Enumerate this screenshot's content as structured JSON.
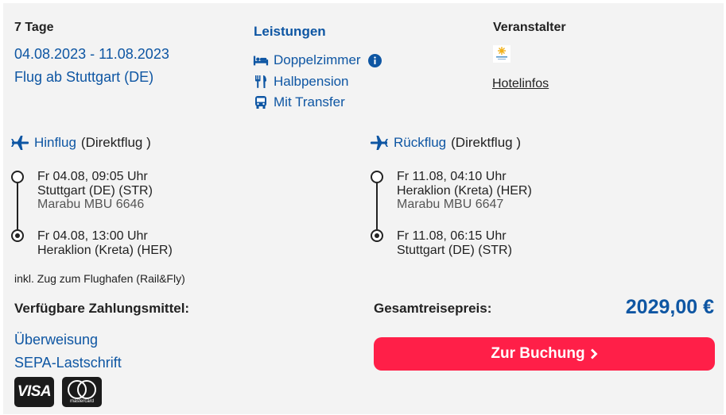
{
  "trip": {
    "duration": "7 Tage",
    "dates": "04.08.2023 - 11.08.2023",
    "departure": "Flug ab Stuttgart (DE)"
  },
  "services": {
    "title": "Leistungen",
    "items": [
      {
        "label": "Doppelzimmer",
        "icon": "bed-icon"
      },
      {
        "label": "Halbpension",
        "icon": "cutlery-icon"
      },
      {
        "label": "Mit Transfer",
        "icon": "bus-icon"
      }
    ]
  },
  "organizer": {
    "title": "Veranstalter",
    "hotel_info_link": "Hotelinfos"
  },
  "outbound": {
    "label": "Hinflug",
    "type": "(Direktflug )",
    "dep_time": "Fr 04.08, 09:05 Uhr",
    "dep_airport": "Stuttgart (DE) (STR)",
    "flight": "Marabu MBU 6646",
    "arr_time": "Fr 04.08, 13:00 Uhr",
    "arr_airport": "Heraklion (Kreta) (HER)"
  },
  "return": {
    "label": "Rückflug",
    "type": "(Direktflug )",
    "dep_time": "Fr 11.08, 04:10 Uhr",
    "dep_airport": "Heraklion (Kreta) (HER)",
    "flight": "Marabu MBU 6647",
    "arr_time": "Fr 11.08, 06:15 Uhr",
    "arr_airport": "Stuttgart (DE) (STR)"
  },
  "rail_note": "inkl. Zug zum Flughafen (Rail&Fly)",
  "payment": {
    "title": "Verfügbare Zahlungsmittel:",
    "methods": [
      "Überweisung",
      "SEPA-Lastschrift"
    ],
    "cards": {
      "visa": "VISA",
      "mastercard": "mastercard"
    }
  },
  "price": {
    "label": "Gesamtreisepreis:",
    "value": "2029,00 €"
  },
  "booking_button": "Zur Buchung",
  "colors": {
    "accent": "#0e56a3",
    "cta": "#ff1f48",
    "background": "#f3f3f3"
  }
}
